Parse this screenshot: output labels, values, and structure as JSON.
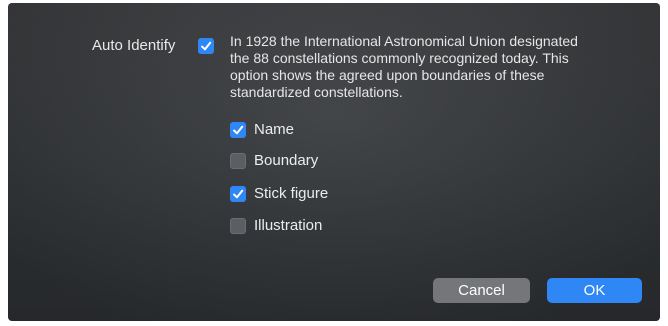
{
  "dialog": {
    "auto_identify_label": "Auto Identify",
    "auto_identify_checked": true,
    "description_lines": [
      "In 1928 the International Astronomical Union designated",
      "the 88 constellations commonly recognized today. This",
      "option shows the agreed upon boundaries of these",
      "standardized constellations."
    ],
    "options": [
      {
        "label": "Name",
        "checked": true
      },
      {
        "label": "Boundary",
        "checked": false
      },
      {
        "label": "Stick figure",
        "checked": true
      },
      {
        "label": "Illustration",
        "checked": false
      }
    ],
    "buttons": {
      "cancel_label": "Cancel",
      "ok_label": "OK"
    }
  },
  "colors": {
    "accent": "#2f86f5",
    "dialog_background": "#383b3e",
    "cancel_button": "#747679",
    "unchecked_box": "#5b5e62"
  }
}
